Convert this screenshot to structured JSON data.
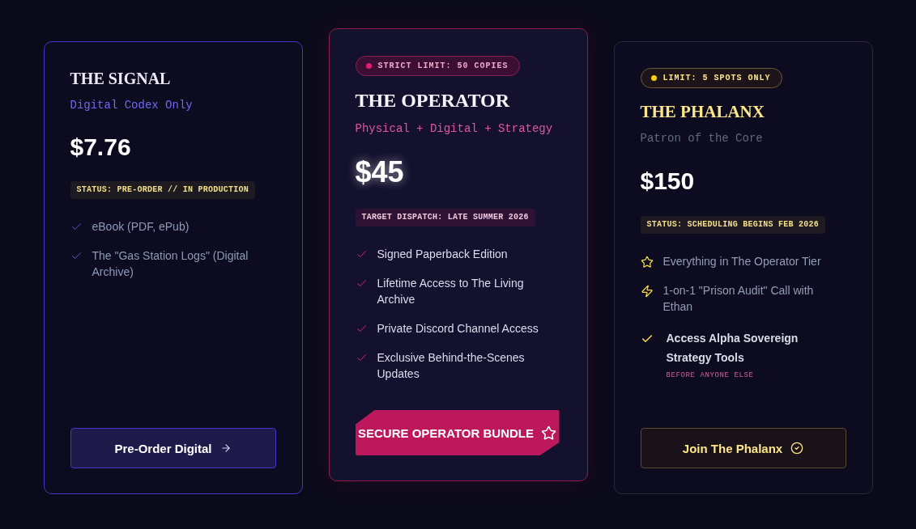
{
  "tiers": [
    {
      "kind": "basic",
      "name": "THE SIGNAL",
      "subtitle": "Digital Codex Only",
      "price": "$7.76",
      "status": "STATUS: PRE-ORDER // IN PRODUCTION",
      "features": [
        {
          "kind": "check",
          "text": "eBook (PDF, ePub)"
        },
        {
          "kind": "check",
          "text": "The \"Gas Station Logs\" (Digital Archive)"
        }
      ],
      "button": "Pre-Order Digital"
    },
    {
      "kind": "featured",
      "badge": "STRICT LIMIT: 50 COPIES",
      "name": "THE OPERATOR",
      "subtitle": "Physical + Digital + Strategy",
      "price": "$45",
      "status": "TARGET DISPATCH: LATE SUMMER 2026",
      "features": [
        {
          "kind": "check",
          "text": "Signed Paperback Edition"
        },
        {
          "kind": "check",
          "text": "Lifetime Access to The Living Archive"
        },
        {
          "kind": "check",
          "text": "Private Discord Channel Access"
        },
        {
          "kind": "check",
          "text": "Exclusive Behind-the-Scenes Updates"
        }
      ],
      "button": "SECURE OPERATOR BUNDLE"
    },
    {
      "kind": "premium",
      "badge": "LIMIT: 5 SPOTS ONLY",
      "name": "THE PHALANX",
      "subtitle": "Patron of the Core",
      "price": "$150",
      "status": "STATUS: SCHEDULING BEGINS FEB 2026",
      "features": [
        {
          "kind": "star",
          "text": "Everything in The Operator Tier"
        },
        {
          "kind": "bolt",
          "text": "1-on-1 \"Prison Audit\" Call with Ethan"
        },
        {
          "kind": "highlight",
          "text": "Access Alpha Sovereign Strategy Tools",
          "note": "BEFORE ANYONE ELSE"
        }
      ],
      "button": "Join The Phalanx"
    }
  ]
}
